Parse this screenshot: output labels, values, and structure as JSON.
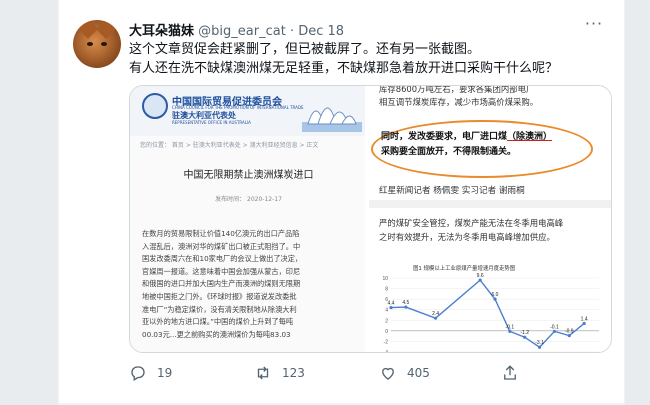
{
  "tweet": {
    "author_name": "大耳朵猫妹",
    "handle": "@big_ear_cat",
    "separator": "·",
    "date": "Dec 18",
    "more": "···",
    "text_line1": "这个文章贸促会赶紧删了，但已被截屏了。还有另一张截图。",
    "text_line2": "有人还在洗不缺煤澳洲煤无足轻重，不缺煤那急着放开进口采购干什么呢？"
  },
  "image_left": {
    "org_cn": "中国国际贸易促进委员会",
    "org_en": "CHINA COUNCIL FOR THE PROMOTION OF INTERNATIONAL TRADE",
    "org_sub": "驻澳大利亚代表处",
    "org_sub_en": "REPRESENTATIVE OFFICE IN AUSTRALIA",
    "breadcrumb": "您的位置： 首页 > 驻澳大利亚代表处 > 澳大利亚经贸信息 > 正文",
    "title": "中国无限期禁止澳洲煤炭进口",
    "pubdate": "发布时间：  2020-12-17",
    "body_l1": "在数月的贸易限制让价值140亿澳元的出口产品陷",
    "body_l2": "入混乱后，澳洲对华的煤矿出口被正式阻挡了。中",
    "body_l3": "国发改委周六在和10家电厂的会议上做出了决定，",
    "body_l4": "官媒周一报道。这意味着中国会加强从蒙古，印尼",
    "body_l5": "和俄国的进口并加大国内生产而澳洲的煤则无限期",
    "body_l6": "地被中国拒之门外。《环球时报》报道说发改委批",
    "body_l7": "准电厂“为稳定煤价，没有清关限制地从除澳大利",
    "body_l8": "亚以外的地方进口煤。”中国的煤价上升到了每吨",
    "body_l9": "00.03元...更之前购买的澳洲煤价为每吨83.03"
  },
  "image_right": {
    "top_l1": "库存8600万吨左右，要求各集团内部电厂",
    "top_l2": "相互调节煤炭库存，减少市场高价煤采购。",
    "hl_l1_a": "同时，发改委要求，电厂进口煤",
    "hl_l1_b": "（除澳洲）",
    "hl_l2": "采购要全面放开，不得限制通关。",
    "reporter": "红星新闻记者 杨佩雯 实习记者 谢雨桐",
    "para_l1": "严的煤矿安全管控，煤炭产能无法在冬季用电高峰",
    "para_l2": "之时有效提升，无法为冬季用电高峰增加供应。",
    "fig_title": "图1  规模以上工业原煤产量增速月度走势图"
  },
  "chart_data": {
    "type": "line",
    "title": "图1  规模以上工业原煤产量增速月度走势图",
    "yticks": [
      "10",
      "8",
      "6",
      "4",
      "2",
      "0",
      "-2",
      "-4"
    ],
    "ylim": [
      -4,
      10
    ],
    "data_labels": [
      "4.4",
      "4.5",
      "2.4",
      "9.6",
      "6.0",
      "-0.1",
      "-1.2",
      "-3.1",
      "-0.1",
      "-0.9",
      "1.4"
    ],
    "values": [
      4.4,
      4.5,
      2.4,
      9.6,
      6.0,
      -0.1,
      -1.2,
      -3.1,
      -0.1,
      -0.9,
      1.4
    ],
    "x_positions": [
      0,
      1,
      3,
      6,
      7,
      8,
      9,
      10,
      11,
      12,
      13
    ]
  },
  "actions": {
    "reply_count": "19",
    "retweet_count": "123",
    "like_count": "405"
  },
  "colors": {
    "highlight_ring": "#ea8a2a",
    "chart_line": "#4a7fd0",
    "org_blue": "#1e4f9e"
  }
}
